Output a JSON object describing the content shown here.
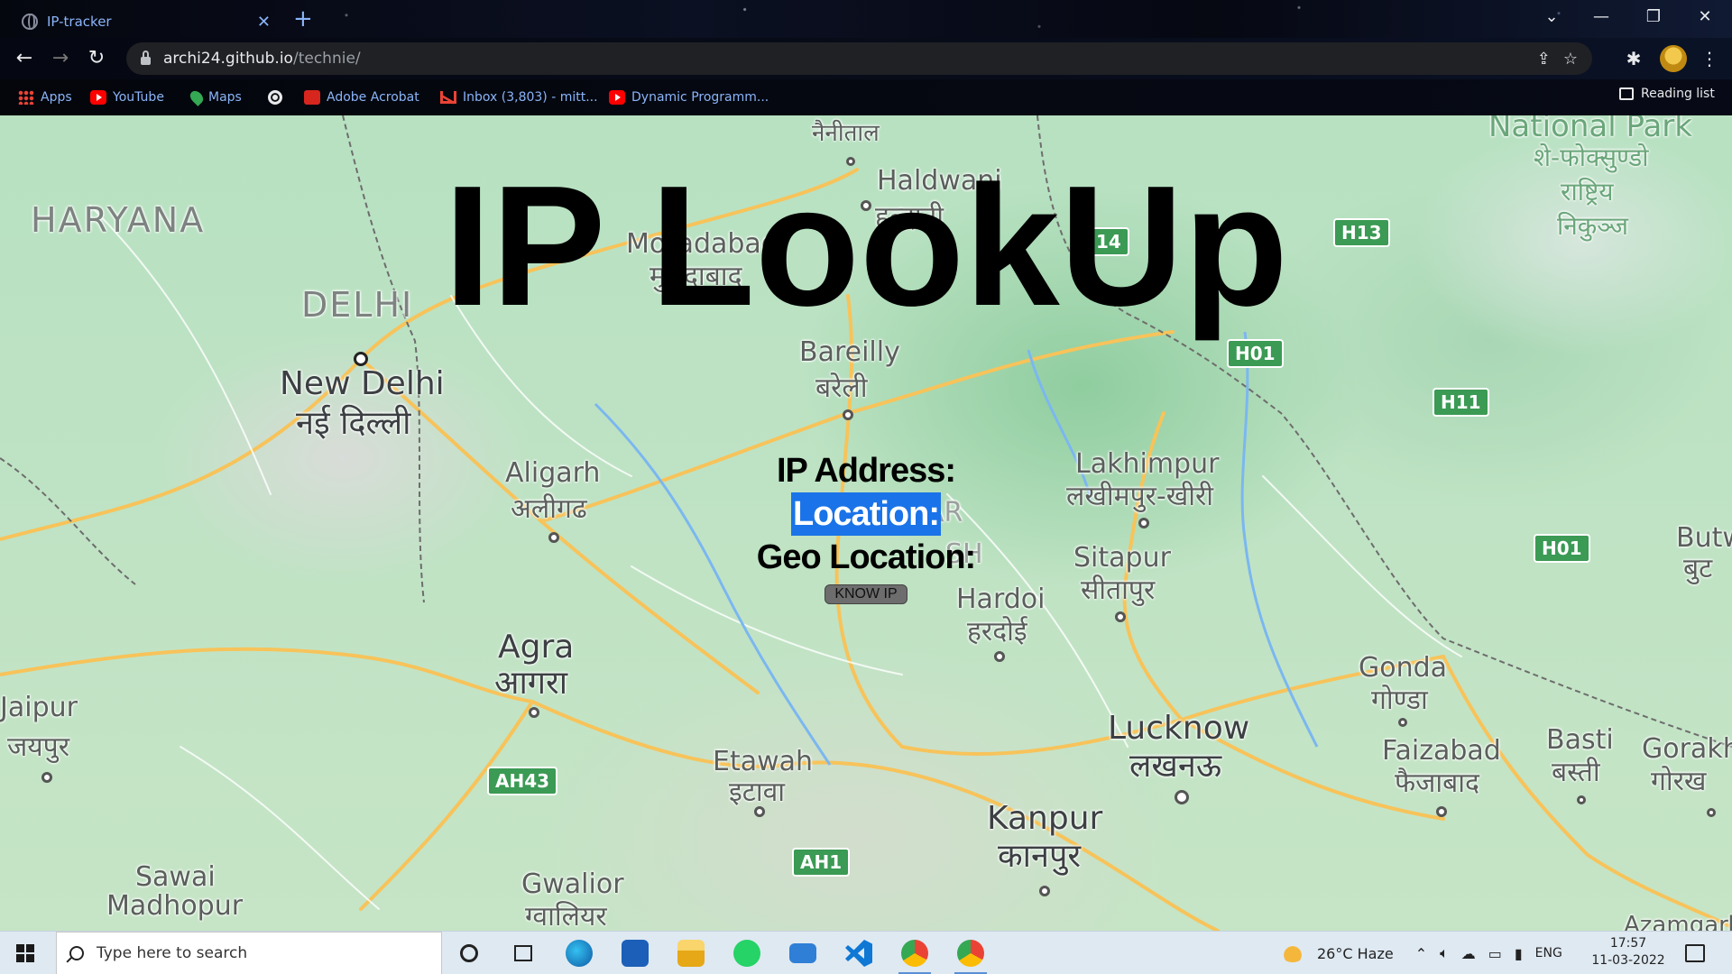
{
  "browser": {
    "tab": {
      "title": "IP-tracker"
    },
    "url": {
      "host": "archi24.github.io",
      "path": "/technie/"
    },
    "bookmarks": [
      {
        "label": "Apps",
        "icon": "apps-grid-icon"
      },
      {
        "label": "YouTube",
        "icon": "youtube-icon"
      },
      {
        "label": "Maps",
        "icon": "maps-pin-icon"
      },
      {
        "label": "",
        "icon": "globe-icon"
      },
      {
        "label": "Adobe Acrobat",
        "icon": "acrobat-icon"
      },
      {
        "label": "Inbox (3,803) - mitt...",
        "icon": "gmail-icon"
      },
      {
        "label": "Dynamic Programm...",
        "icon": "youtube-icon"
      }
    ],
    "reading_list": "Reading list"
  },
  "page": {
    "title": "IP LookUp",
    "ip_label": "IP Address:",
    "location_label": "Location:",
    "geo_label": "Geo Location:",
    "button_label": "KNOW IP"
  },
  "map": {
    "labels": {
      "haryana": "HARYANA",
      "delhi": "DELHI",
      "new_delhi": "New Delhi",
      "new_delhi_hi": "नई दिल्ली",
      "jaipur": "Jaipur",
      "jaipur_hi": "जयपुर",
      "aligarh": "Aligarh",
      "aligarh_hi": "अलीगढ",
      "agra": "Agra",
      "agra_hi": "आगरा",
      "sawai": "Sawai",
      "madhopur": "Madhopur",
      "gwalior": "Gwalior",
      "gwalior_hi": "ग्वालियर",
      "etawah": "Etawah",
      "etawah_hi": "इटावा",
      "kanpur": "Kanpur",
      "kanpur_hi": "कानपुर",
      "lucknow": "Lucknow",
      "lucknow_hi": "लखनऊ",
      "hardoi": "Hardoi",
      "hardoi_hi": "हरदोई",
      "sitapur": "Sitapur",
      "sitapur_hi": "सीतापुर",
      "lakhimpur": "Lakhimpur",
      "lakhimpur_hi": "लखीमपुर-खीरी",
      "bareilly": "Bareilly",
      "bareilly_hi": "बरेली",
      "moradabad": "Moradabad",
      "moradabad_hi": "मुरादाबाद",
      "haldwani": "Haldwani",
      "haldwani_hi": "हल्द्वानी",
      "nainital_hi": "नैनीताल",
      "gonda": "Gonda",
      "gonda_hi": "गोण्डा",
      "faizabad": "Faizabad",
      "faizabad_hi": "फैजाबाद",
      "basti": "Basti",
      "basti_hi": "बस्ती",
      "gorakh": "Gorakh",
      "gorakh_hi": "गोरख",
      "butw": "Butw",
      "butw_hi": "बुट",
      "uttar_fragment": "AR",
      "pradesh_fragment": "SH",
      "national_park": "National Park",
      "park_hi1": "शे-फोक्सुण्डो",
      "park_hi2": "राष्ट्रिय",
      "park_hi3": "निकुञ्ज",
      "azamgarh": "Azamgarh"
    },
    "shields": {
      "h13": "H13",
      "h01a": "H01",
      "h11": "H11",
      "h01b": "H01",
      "ah43": "AH43",
      "ah1": "AH1",
      "n14": "14"
    }
  },
  "taskbar": {
    "search_placeholder": "Type here to search",
    "weather": "26°C  Haze",
    "language": "ENG",
    "time": "17:57",
    "date": "11-03-2022"
  },
  "colors": {
    "accent_blue": "#1a73e8",
    "map_green": "#b7e1c1",
    "road_yellow": "#f7c35a"
  }
}
